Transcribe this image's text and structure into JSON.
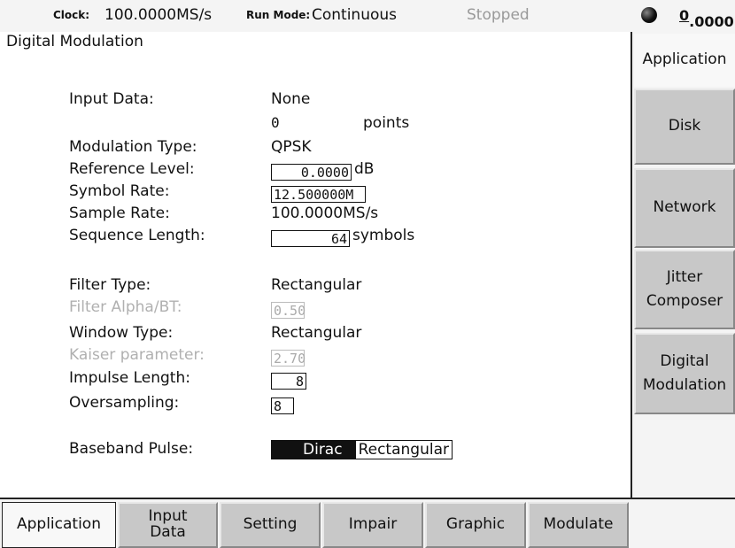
{
  "status": {
    "clock_label": "Clock:",
    "clock_value": "100.0000MS/s",
    "run_mode_label": "Run Mode:",
    "run_mode_value": "Continuous",
    "state": "Stopped",
    "indicator_icon": "status-led-icon",
    "value_prefix": "0",
    "value_rest": ".0000"
  },
  "main": {
    "title": "Digital Modulation",
    "input_data": {
      "label": "Input Data:",
      "value": "None",
      "points_value": "0",
      "points_unit": "points"
    },
    "modulation_type": {
      "label": "Modulation Type:",
      "value": "QPSK"
    },
    "reference_level": {
      "label": "Reference Level:",
      "value": "0.0000",
      "unit": "dB"
    },
    "symbol_rate": {
      "label": "Symbol Rate:",
      "value": "12.500000M"
    },
    "sample_rate": {
      "label": "Sample Rate:",
      "value": "100.0000MS/s"
    },
    "sequence_length": {
      "label": "Sequence Length:",
      "value": "64",
      "unit": "symbols"
    },
    "filter_type": {
      "label": "Filter Type:",
      "value": "Rectangular"
    },
    "filter_alpha": {
      "label": "Filter Alpha/BT:",
      "value": "0.50"
    },
    "window_type": {
      "label": "Window Type:",
      "value": "Rectangular"
    },
    "kaiser": {
      "label": "Kaiser parameter:",
      "value": "2.70"
    },
    "impulse_length": {
      "label": "Impulse Length:",
      "value": "8"
    },
    "oversampling": {
      "label": "Oversampling:",
      "value": "8"
    },
    "baseband_pulse": {
      "label": "Baseband Pulse:",
      "options": [
        "Dirac",
        "Rectangular"
      ],
      "selected": "Dirac"
    }
  },
  "side_menu": {
    "header": "Application",
    "items": [
      {
        "label": "Disk"
      },
      {
        "label": "Network"
      },
      {
        "label_line1": "Jitter",
        "label_line2": "Composer"
      },
      {
        "label_line1": "Digital",
        "label_line2": "Modulation"
      }
    ]
  },
  "bottom_menu": {
    "items": [
      {
        "label": "Application"
      },
      {
        "label_line1": "Input",
        "label_line2": "Data"
      },
      {
        "label": "Setting"
      },
      {
        "label": "Impair"
      },
      {
        "label": "Graphic"
      },
      {
        "label": "Modulate"
      }
    ]
  },
  "colors": {
    "panel": "#f4f4f4",
    "button_gray": "#c8c8c8",
    "disabled_text": "#b0b0b0",
    "selected_toggle": "#111111"
  }
}
